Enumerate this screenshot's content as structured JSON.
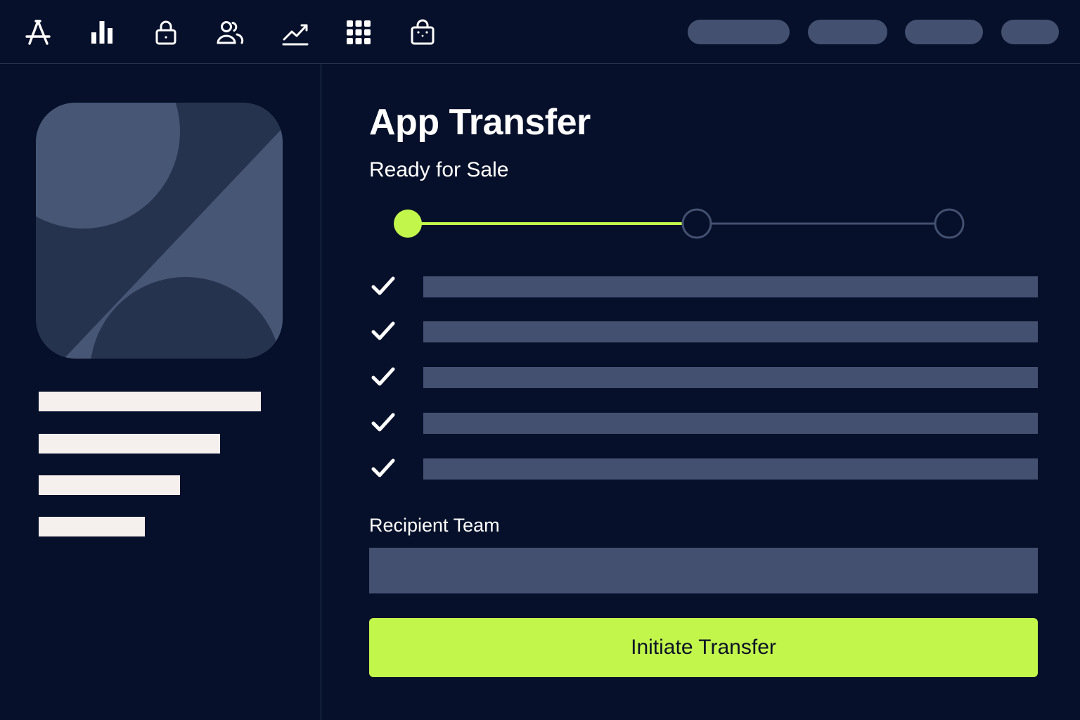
{
  "toolbar": {
    "icons": [
      "app-store-icon",
      "bar-chart-icon",
      "lock-icon",
      "users-icon",
      "trend-icon",
      "grid-icon",
      "shopping-bag-icon"
    ]
  },
  "app": {
    "title": "App Transfer",
    "status": "Ready for Sale"
  },
  "stepper": {
    "total_steps": 3,
    "completed_steps": 1
  },
  "checklist": {
    "count": 5,
    "all_checked": true
  },
  "recipient": {
    "label": "Recipient Team",
    "value": ""
  },
  "actions": {
    "initiate_label": "Initiate Transfer"
  },
  "colors": {
    "background": "#06102a",
    "accent": "#c3f64b",
    "placeholder_bar": "#435070",
    "light_bar": "#f5efee",
    "divider": "#2a3550"
  }
}
